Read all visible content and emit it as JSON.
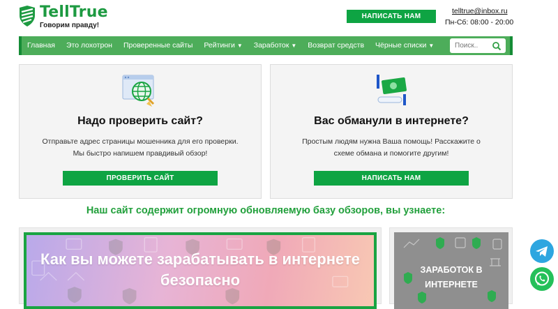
{
  "brand": {
    "name": "TellTrue",
    "tagline": "Говорим правду!",
    "color": "#1d9a41"
  },
  "header": {
    "cta_label": "НАПИСАТЬ НАМ",
    "email": "telltrue@inbox.ru",
    "hours": "Пн-Сб: 08:00 - 20:00"
  },
  "nav": {
    "items": [
      {
        "label": "Главная"
      },
      {
        "label": "Это лохотрон"
      },
      {
        "label": "Проверенные сайты"
      },
      {
        "label": "Рейтинги",
        "dropdown": true
      },
      {
        "label": "Заработок",
        "dropdown": true
      },
      {
        "label": "Возврат средств"
      },
      {
        "label": "Чёрные списки",
        "dropdown": true
      }
    ],
    "caret": "▼",
    "search_placeholder": "Поиск..",
    "color": "#4dad5a"
  },
  "cards": [
    {
      "icon": "globe-magnifier-icon",
      "title": "Надо проверить сайт?",
      "text": "Отправьте адрес страницы мошенника для его проверки. Мы быстро напишем правдивый обзор!",
      "button": "ПРОВЕРИТЬ САЙТ"
    },
    {
      "icon": "money-hand-icon",
      "title": "Вас обманули в интернете?",
      "text": "Простым людям нужна Ваша помощь! Расскажите о схеме обмана и помогите другим!",
      "button": "НАПИСАТЬ НАМ"
    }
  ],
  "section_title": "Наш сайт содержит огромную обновляемую базу обзоров, вы узнаете:",
  "banners": {
    "main": "Как вы можете зарабатывать в интернете безопасно",
    "side": "ЗАРАБОТОК В ИНТЕРНЕТЕ"
  },
  "floating": {
    "telegram": "telegram-icon",
    "whatsapp": "whatsapp-icon"
  },
  "colors": {
    "accent": "#0ea443",
    "telegram": "#2ea6e0",
    "whatsapp": "#25c05a"
  }
}
